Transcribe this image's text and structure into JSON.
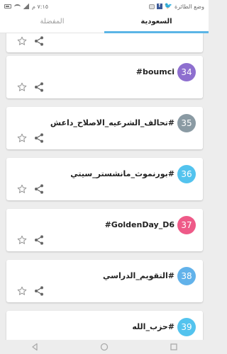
{
  "status_bar": {
    "time": "٧:١٥ م",
    "notification_text": "وضع الطائرة"
  },
  "tabs": [
    {
      "label": "السعودية",
      "active": true
    },
    {
      "label": "المفضلة",
      "active": false
    }
  ],
  "items": [
    {
      "rank": "",
      "tag": "",
      "color": "#ffffff"
    },
    {
      "rank": "34",
      "tag": "#boumci",
      "color": "#8e6fcf"
    },
    {
      "rank": "35",
      "tag": "#تحالف_الشرعيه_الاصلاح_داعش",
      "color": "#8a9aa3"
    },
    {
      "rank": "36",
      "tag": "#بورنموث_مانشستر_سيتي",
      "color": "#53c3ee"
    },
    {
      "rank": "37",
      "tag": "#GoldenDay_D6",
      "color": "#ee5a88"
    },
    {
      "rank": "38",
      "tag": "#التقويم_الدراسي",
      "color": "#62b2ea"
    },
    {
      "rank": "39",
      "tag": "#حزب_الله",
      "color": "#53c3ee"
    }
  ],
  "icons": {
    "favorite": "star-outline-icon",
    "share": "share-icon"
  }
}
